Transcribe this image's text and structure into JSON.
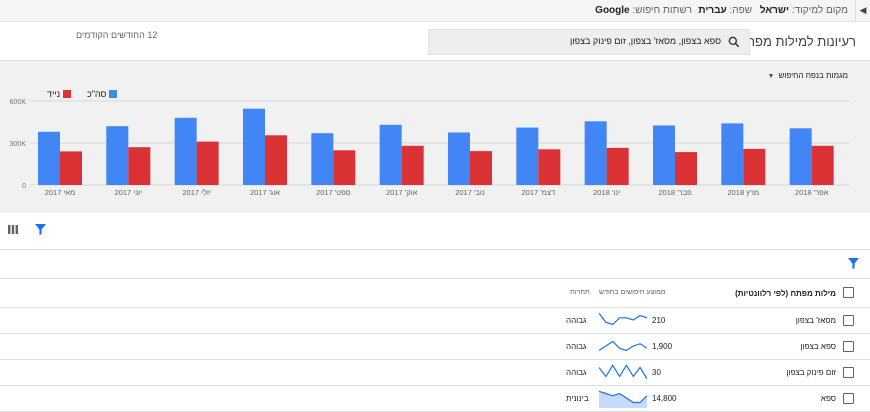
{
  "topbar": {
    "location_label": "מקום למיקוד:",
    "location_value": "ישראל",
    "language_label": "שפה:",
    "language_value": "עברית",
    "network_label": "רשתות חיפוש:",
    "network_value": "Google",
    "collapse_icon": "triangle-right-icon"
  },
  "header": {
    "title": "רעיונות למילות מפתח",
    "search_value": "ספא בצפון, מסאז' בצפון, זום פינוק בצפון",
    "date_range": "12 החודשים הקודמים"
  },
  "trend_dropdown": "מגמות בנפח החיפוש",
  "legend": {
    "total": "סה\"כ",
    "mobile": "נייד"
  },
  "colors": {
    "total": "#4285f4",
    "mobile": "#db3236",
    "accent": "#1a73e8"
  },
  "chart_data": {
    "type": "bar",
    "categories": [
      "מאי 2017",
      "יוני 2017",
      "יולי 2017",
      "אוג' 2017",
      "ספט' 2017",
      "אוק' 2017",
      "נוב' 2017",
      "דצמ' 2017",
      "ינו' 2018",
      "פבר' 2018",
      "מרץ 2018",
      "אפר' 2018"
    ],
    "series": [
      {
        "name": "סה\"כ",
        "values": [
          380000,
          420000,
          480000,
          545000,
          370000,
          430000,
          375000,
          410000,
          455000,
          425000,
          440000,
          405000
        ]
      },
      {
        "name": "נייד",
        "values": [
          240000,
          270000,
          310000,
          355000,
          248000,
          280000,
          242000,
          255000,
          265000,
          235000,
          258000,
          280000
        ]
      }
    ],
    "yticks": [
      "0",
      "300K",
      "600K"
    ],
    "ylim": [
      0,
      600000
    ],
    "grid": true
  },
  "table": {
    "header": {
      "keyword": "מילות מפתח (לפי רלוונטיות)",
      "search_volume": "ממוצע חיפושים בחודש",
      "competition": "תחרות"
    },
    "rows": [
      {
        "keyword": "מסאז' בצפון",
        "volume": "210",
        "competition": "גבוהה",
        "trend": [
          7,
          3,
          2,
          5,
          5,
          4,
          6,
          5
        ],
        "fill": false
      },
      {
        "keyword": "ספא בצפון",
        "volume": "1,900",
        "competition": "גבוהה",
        "trend": [
          2,
          4,
          6,
          3,
          2,
          4,
          5,
          3
        ],
        "fill": false
      },
      {
        "keyword": "זום פינוק בצפון",
        "volume": "30",
        "competition": "גבוהה",
        "trend": [
          6,
          2,
          7,
          2,
          7,
          2,
          6,
          1
        ],
        "fill": false
      },
      {
        "keyword": "ספא",
        "volume": "14,800",
        "competition": "בינונית",
        "trend": [
          7,
          6,
          5,
          6,
          4,
          2,
          2,
          5
        ],
        "fill": true
      }
    ]
  },
  "icons": {
    "search": "search-icon",
    "filter": "filter-icon",
    "columns": "columns-icon"
  }
}
